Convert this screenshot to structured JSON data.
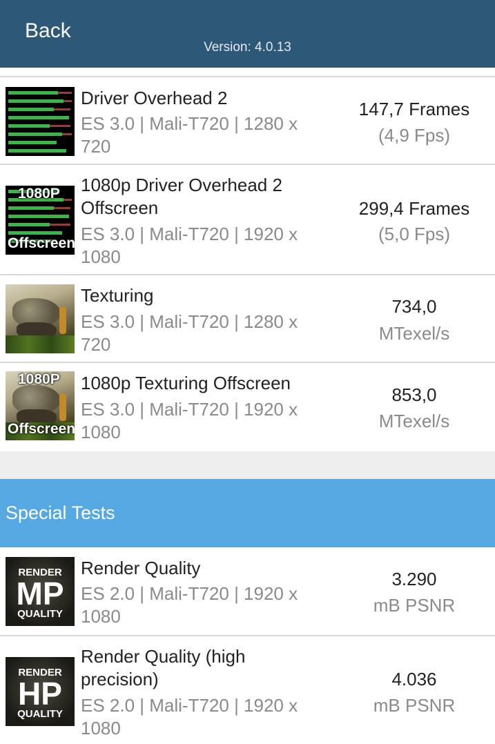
{
  "header": {
    "back_label": "Back",
    "version": "Version: 4.0.13"
  },
  "tests": [
    {
      "name": "Driver Overhead 2",
      "detail": "ES 3.0 | Mali-T720 | 1280 x 720",
      "value": "147,7 Frames",
      "unit": "(4,9 Fps)",
      "thumb": "driver-overhead"
    },
    {
      "name": "1080p Driver Overhead 2 Offscreen",
      "detail": "ES 3.0 | Mali-T720 | 1920 x 1080",
      "value": "299,4 Frames",
      "unit": "(5,0 Fps)",
      "thumb": "driver-overhead",
      "thumb_top": "1080P",
      "thumb_bottom": "Offscreen"
    },
    {
      "name": "Texturing",
      "detail": "ES 3.0 | Mali-T720 | 1280 x 720",
      "value": "734,0",
      "unit": "MTexel/s",
      "thumb": "dinosaur"
    },
    {
      "name": "1080p Texturing Offscreen",
      "detail": "ES 3.0 | Mali-T720 | 1920 x 1080",
      "value": "853,0",
      "unit": "MTexel/s",
      "thumb": "dinosaur",
      "thumb_top": "1080P",
      "thumb_bottom": "Offscreen"
    }
  ],
  "special": {
    "title": "Special Tests",
    "tests": [
      {
        "name": "Render Quality",
        "detail": "ES 2.0 | Mali-T720 | 1920 x 1080",
        "value": "3.290",
        "unit": "mB PSNR",
        "thumb_top": "RENDER",
        "thumb_big": "MP",
        "thumb_bottom": "QUALITY"
      },
      {
        "name": "Render Quality (high precision)",
        "detail": "ES 2.0 | Mali-T720 | 1920 x 1080",
        "value": "4.036",
        "unit": "mB PSNR",
        "thumb_top": "RENDER",
        "thumb_big": "HP",
        "thumb_bottom": "QUALITY"
      }
    ]
  }
}
